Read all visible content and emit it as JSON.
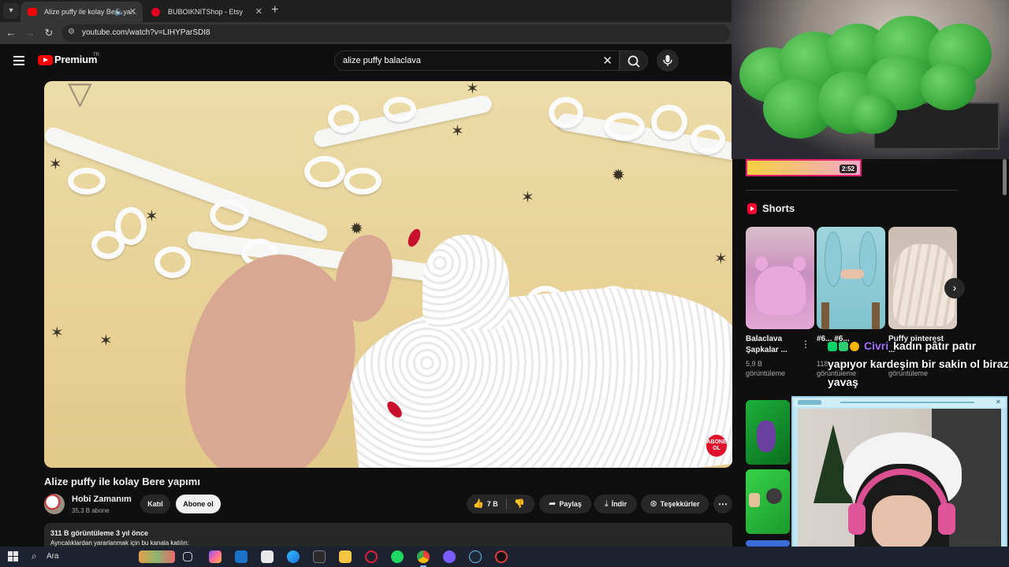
{
  "browser": {
    "tabs": [
      {
        "title": "Alize puffy ile kolay Bere ya..."
      },
      {
        "title": "BUBOIKNITShop - Etsy"
      }
    ],
    "url": "youtube.com/watch?v=LIHYParSDI8"
  },
  "youtube": {
    "logo_text": "Premium",
    "region": "TR",
    "search_value": "alize puffy balaclava",
    "video": {
      "badge_text": "ABONE OL",
      "title": "Alize puffy ile kolay Bere yapımı",
      "channel": "Hobi Zamanım",
      "subscribers": "35,3 B abone",
      "join_label": "Katıl",
      "subscribe_label": "Abone ol",
      "likes": "7 B",
      "share_label": "Paylaş",
      "download_label": "İndir",
      "thanks_label": "Teşekkürler",
      "meta": "311 B görüntüleme  3 yıl önce",
      "description": "Ayrıcalıklardan yararlanmak için bu kanala katılın:"
    },
    "sidebar": {
      "top_duration": "2:52",
      "shorts_heading": "Shorts",
      "shorts": [
        {
          "title": "Balaclava Şapkalar ...",
          "views": "5,9 B görüntüleme"
        },
        {
          "title": "#6...  #6...",
          "views": "118 görüntüleme"
        },
        {
          "title": "Puffy pinterest ...",
          "views": "görüntüleme"
        }
      ]
    }
  },
  "overlay": {
    "chat_nick": "Civri",
    "chat_message": "kadın pâtır patır yapıyor kardeşim bir sakin ol biraz yavaş"
  },
  "taskbar": {
    "search_label": "Ara"
  },
  "colors": {
    "accent_red": "#ff0000",
    "chat_nick": "#a970ff",
    "webcam_frame": "#9cd3e6"
  }
}
